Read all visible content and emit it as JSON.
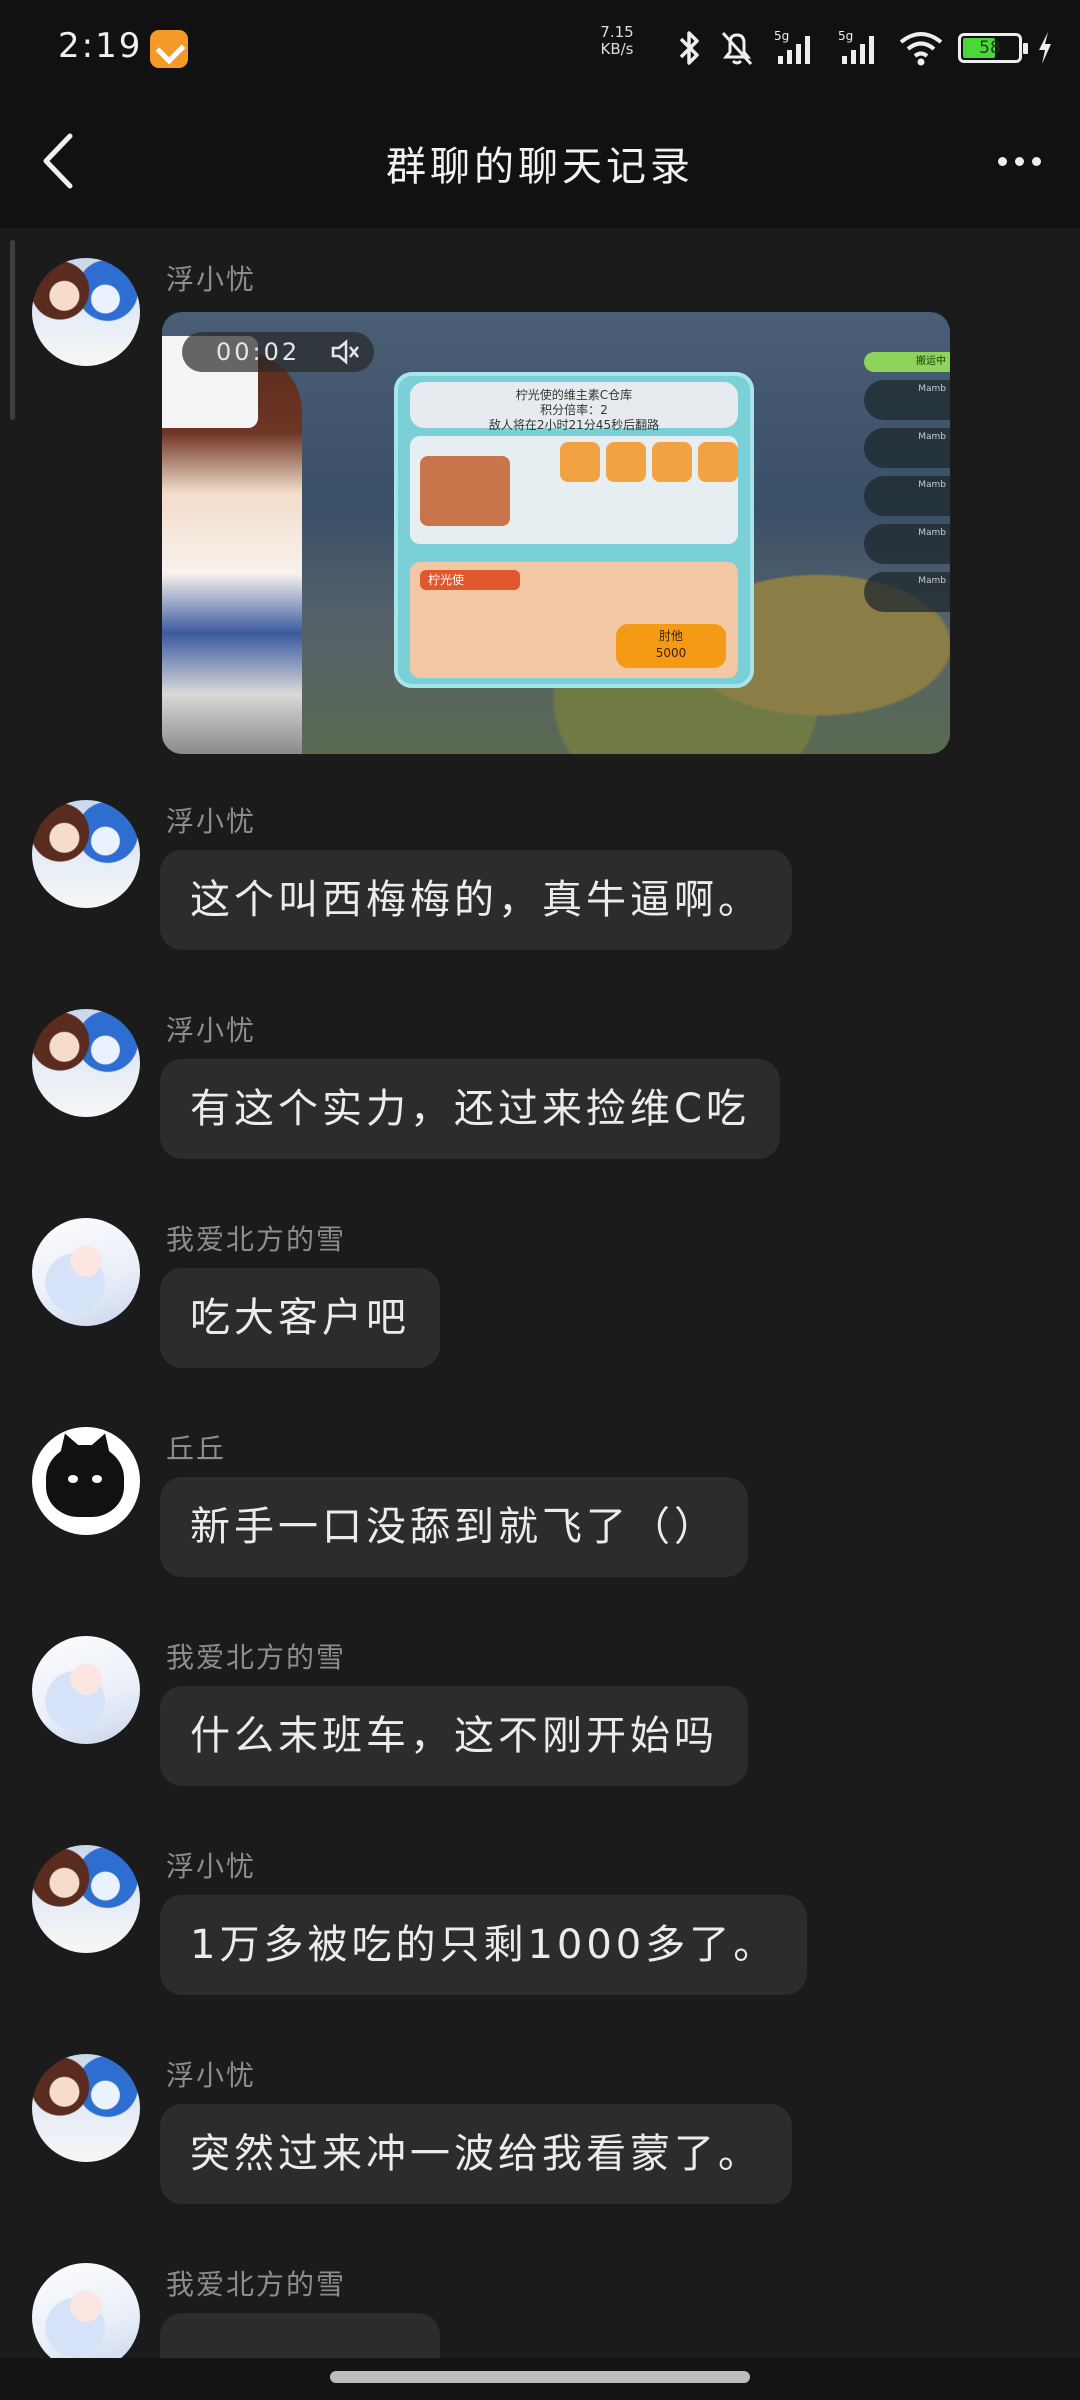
{
  "status_bar": {
    "time": "2:19",
    "net_speed_value": "7.15",
    "net_speed_unit": "KB/s",
    "battery_level": "58",
    "battery_color": "#4ad63c"
  },
  "nav": {
    "title": "群聊的聊天记录"
  },
  "video": {
    "time": "00:02",
    "overlay_title_line1": "柠光使的维主素C仓库",
    "overlay_title_line2": "积分倍率：2",
    "overlay_title_line3": "敌人将在2小时21分45秒后翻路",
    "overlay_tag": "柠光使",
    "overlay_button_line1": "肘他",
    "overlay_button_line2": "5000",
    "overlay_side_top": "搬运中",
    "overlay_member": "Mamb"
  },
  "messages": [
    {
      "sender": "浮小忧",
      "avatar": "fu",
      "type": "video"
    },
    {
      "sender": "浮小忧",
      "avatar": "fu",
      "text": "这个叫西梅梅的，真牛逼啊。"
    },
    {
      "sender": "浮小忧",
      "avatar": "fu",
      "text": "有这个实力，还过来捡维C吃"
    },
    {
      "sender": "我爱北方的雪",
      "avatar": "xue",
      "text": "吃大客户吧"
    },
    {
      "sender": "丘丘",
      "avatar": "qiu",
      "text": "新手一口没舔到就飞了（）"
    },
    {
      "sender": "我爱北方的雪",
      "avatar": "xue",
      "text": "什么末班车，这不刚开始吗"
    },
    {
      "sender": "浮小忧",
      "avatar": "fu",
      "text": "1万多被吃的只剩1000多了。"
    },
    {
      "sender": "浮小忧",
      "avatar": "fu",
      "text": "突然过来冲一波给我看蒙了。"
    },
    {
      "sender": "我爱北方的雪",
      "avatar": "xue",
      "text": ""
    }
  ]
}
